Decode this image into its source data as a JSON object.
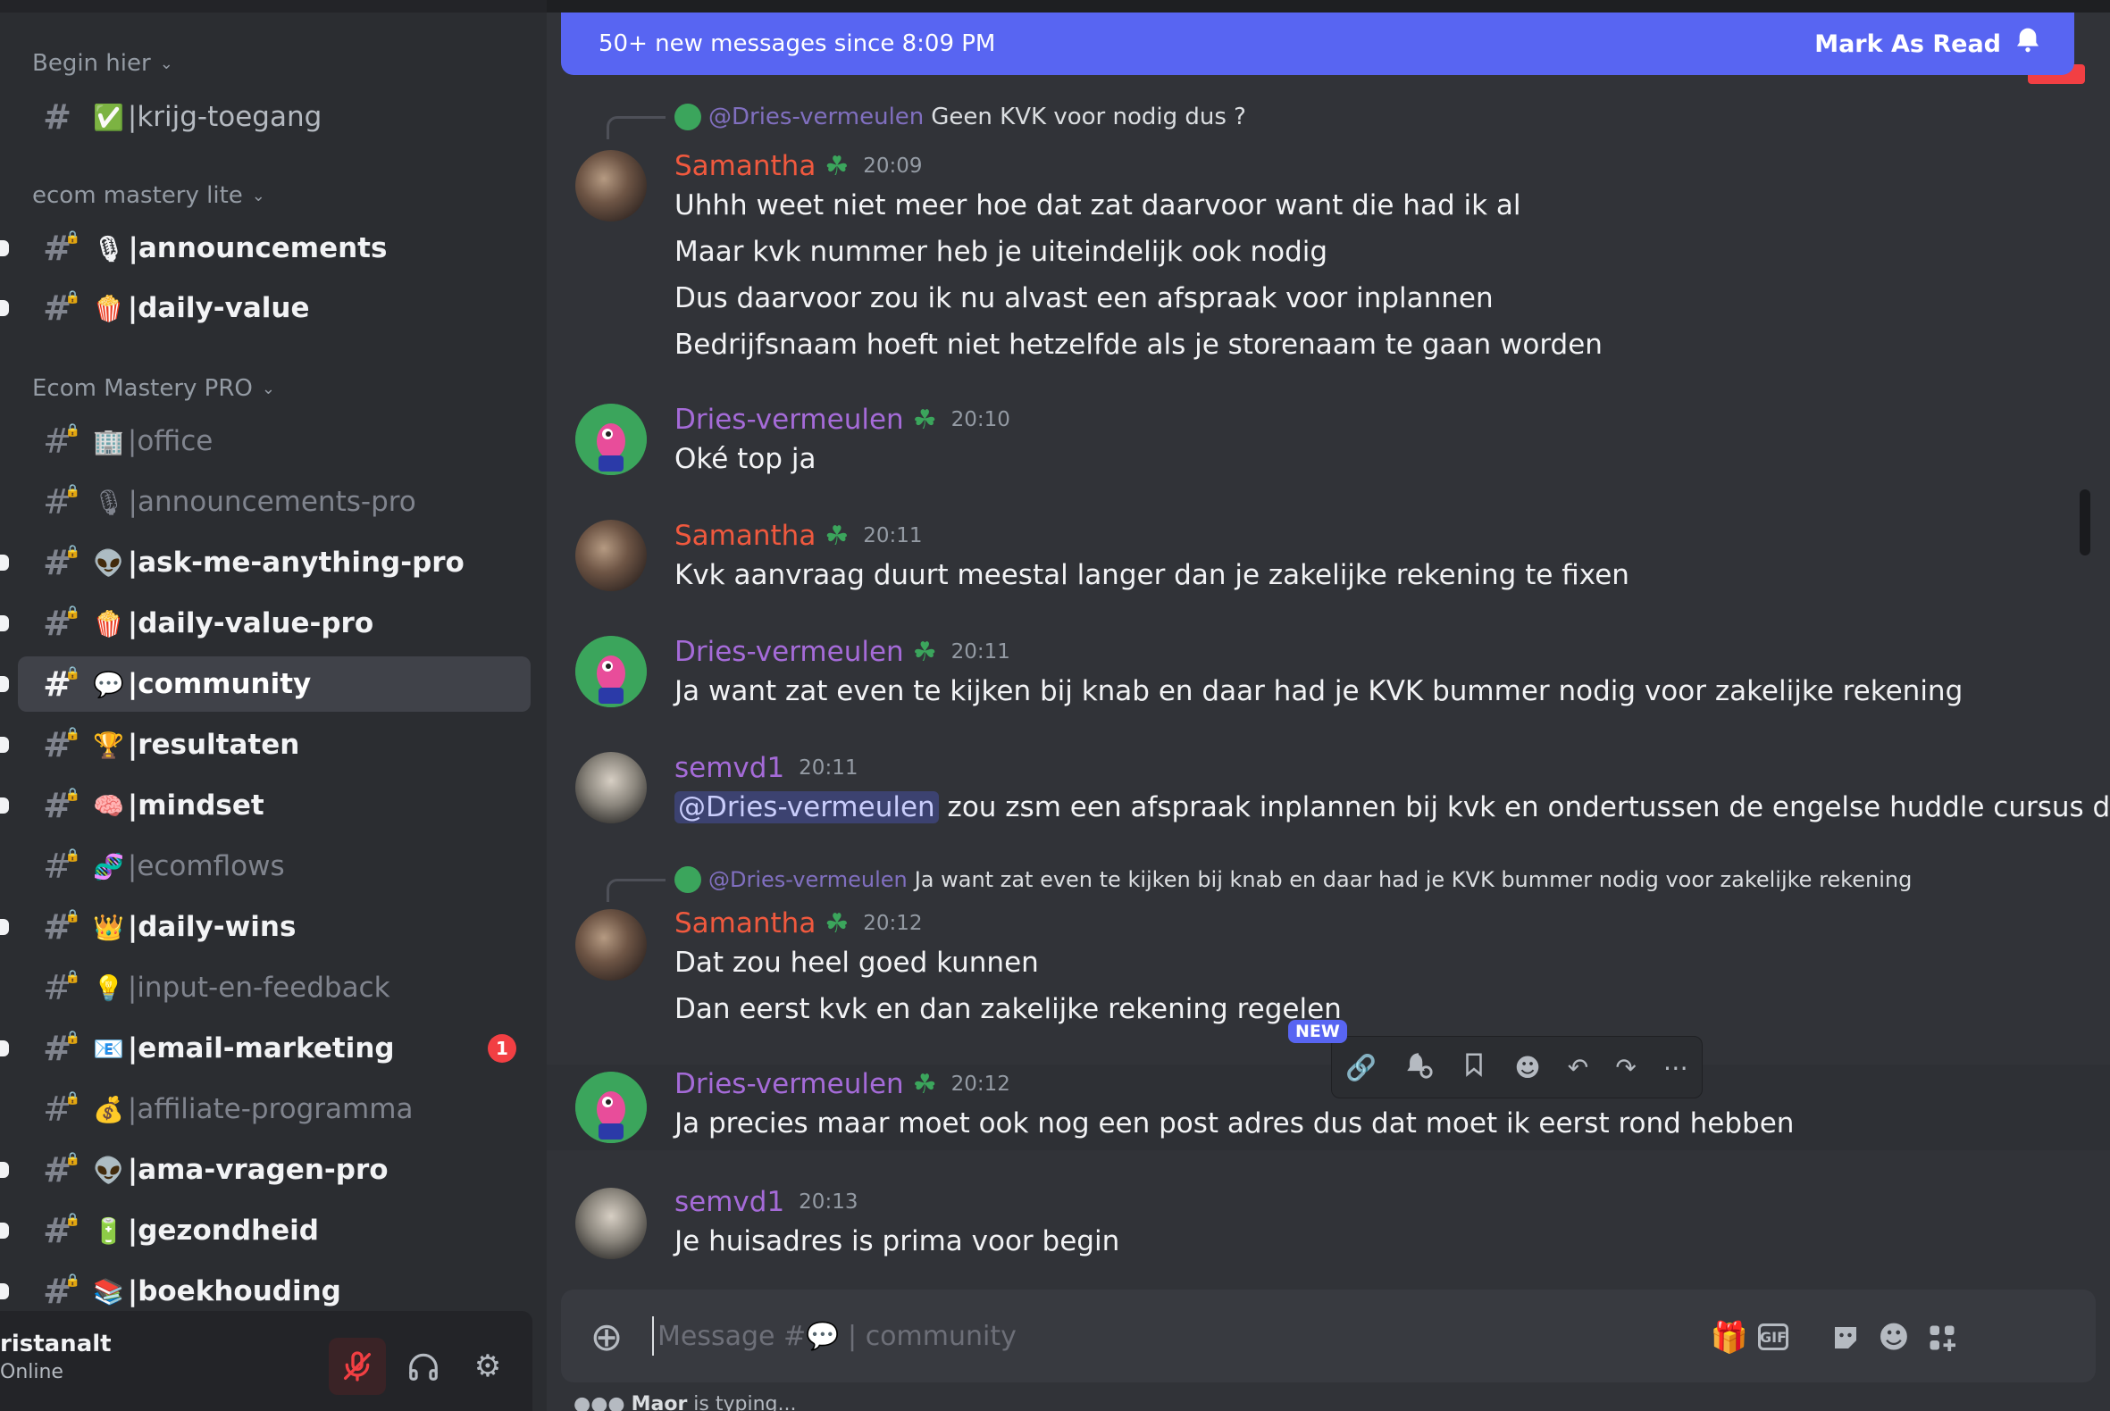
{
  "sidebar": {
    "categories": {
      "begin": "Begin hier",
      "lite": "ecom mastery lite",
      "pro": "Ecom Mastery PRO"
    },
    "channels": {
      "krijg_toegang": {
        "emoji": "✅",
        "name": "|krijg-toegang"
      },
      "announcements": {
        "emoji": "🎙",
        "name": "|announcements"
      },
      "daily_value": {
        "emoji": "🍿",
        "name": "|daily-value"
      },
      "office": {
        "emoji": "🏢",
        "name": "|office"
      },
      "announcements_pro": {
        "emoji": "🎙",
        "name": "|announcements-pro"
      },
      "ama_pro": {
        "emoji": "👽",
        "name": "|ask-me-anything-pro"
      },
      "daily_value_pro": {
        "emoji": "🍿",
        "name": "|daily-value-pro"
      },
      "community": {
        "emoji": "💬",
        "name": "|community"
      },
      "resultaten": {
        "emoji": "🏆",
        "name": "|resultaten"
      },
      "mindset": {
        "emoji": "🧠",
        "name": "|mindset"
      },
      "ecomflows": {
        "emoji": "🧬",
        "name": "|ecomflows"
      },
      "daily_wins": {
        "emoji": "👑",
        "name": "|daily-wins"
      },
      "input": {
        "emoji": "💡",
        "name": "|input-en-feedback"
      },
      "email": {
        "emoji": "📧",
        "name": "|email-marketing",
        "badge": "1"
      },
      "affiliate": {
        "emoji": "💰",
        "name": "|affiliate-programma"
      },
      "ama_vragen": {
        "emoji": "👽",
        "name": "|ama-vragen-pro"
      },
      "gezondheid": {
        "emoji": "🔋",
        "name": "|gezondheid"
      },
      "boekhouding": {
        "emoji": "📚",
        "name": "|boekhouding"
      }
    }
  },
  "user": {
    "name": "ristanalt",
    "status": "Online"
  },
  "banner": {
    "text": "50+ new messages since 8:09 PM",
    "action": "Mark As Read"
  },
  "messages": {
    "m1": {
      "reply_name": "@Dries-vermeulen",
      "reply_text": "Geen KVK voor nodig dus ?",
      "author": "Samantha",
      "time": "20:09",
      "lines": [
        "Uhhh weet niet meer hoe dat zat daarvoor want die had ik al",
        "Maar kvk nummer heb je uiteindelijk ook nodig",
        "Dus daarvoor zou ik nu alvast een afspraak voor inplannen",
        "Bedrijfsnaam hoeft niet hetzelfde als je storenaam te gaan worden"
      ]
    },
    "m2": {
      "author": "Dries-vermeulen",
      "time": "20:10",
      "lines": [
        "Oké top ja"
      ]
    },
    "m3": {
      "author": "Samantha",
      "time": "20:11",
      "lines": [
        "Kvk aanvraag duurt meestal langer dan je zakelijke rekening te fixen"
      ]
    },
    "m4": {
      "author": "Dries-vermeulen",
      "time": "20:11",
      "lines": [
        "Ja want zat even te kijken bij knab en daar had je KVK bummer nodig voor zakelijke rekening"
      ]
    },
    "m5": {
      "author": "semvd1",
      "time": "20:11",
      "mention": "@Dries-vermeulen",
      "text": "zou zsm een afspraak inplannen bij kvk en ondertussen de engelse huddle cursus doorlopen"
    },
    "m6": {
      "reply_name": "@Dries-vermeulen",
      "reply_text": "Ja want zat even te kijken bij knab en daar had je KVK bummer nodig voor zakelijke rekening",
      "author": "Samantha",
      "time": "20:12",
      "lines": [
        "Dat zou heel goed kunnen",
        "Dan eerst kvk en dan zakelijke rekening regelen"
      ]
    },
    "m7": {
      "author": "Dries-vermeulen",
      "time": "20:12",
      "lines": [
        "Ja precies maar moet ook nog een post adres dus dat moet ik eerst rond hebben"
      ]
    },
    "m8": {
      "author": "semvd1",
      "time": "20:13",
      "lines": [
        "Je huisadres is prima voor begin"
      ]
    }
  },
  "toolbar": {
    "new_label": "NEW"
  },
  "composer": {
    "placeholder": "Message #💬 | community"
  },
  "typing": {
    "user": "Maor",
    "text": " is typing..."
  },
  "colors": {
    "samantha": "#f0593e",
    "dries": "#a56bd8",
    "semvd1": "#a56bd8",
    "accent": "#5865f2",
    "mention_badge": "#f23f43"
  }
}
